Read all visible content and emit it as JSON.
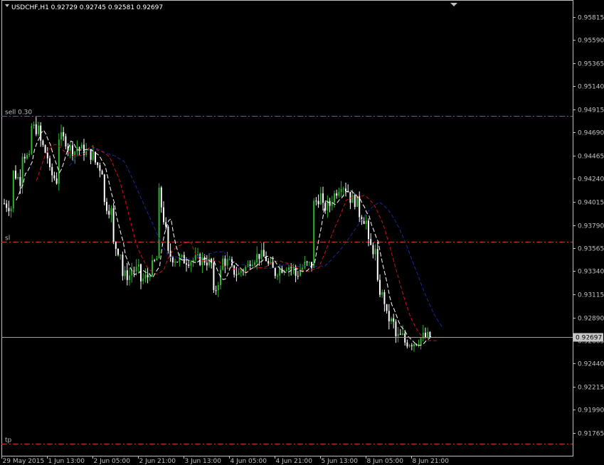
{
  "chart_data": {
    "type": "candlestick",
    "title": "USDCHF,H1 0.92729 0.92745 0.92581 0.92697",
    "symbol": "USDCHF",
    "timeframe": "H1",
    "ohlc_header": {
      "open": "0.92729",
      "high": "0.92745",
      "low": "0.92581",
      "close": "0.92697"
    },
    "current_price": 0.92697,
    "current_price_label": "0.92697",
    "ylim": [
      0.9155,
      0.9598
    ],
    "y_ticks": [
      0.95815,
      0.9559,
      0.95365,
      0.9514,
      0.94915,
      0.9469,
      0.94465,
      0.9424,
      0.94015,
      0.9379,
      0.93565,
      0.9334,
      0.93115,
      0.9289,
      0.92665,
      0.9244,
      0.92215,
      0.9199,
      0.91765
    ],
    "y_tick_labels": [
      "0.95815",
      "0.95590",
      "0.95365",
      "0.95140",
      "0.94915",
      "0.94690",
      "0.94465",
      "0.94240",
      "0.94015",
      "0.93790",
      "0.93565",
      "0.93340",
      "0.93115",
      "0.92890",
      "0.92665",
      "0.92440",
      "0.92215",
      "0.91990",
      "0.91765"
    ],
    "x_tick_labels": [
      "29 May 2015",
      "1 Jun 13:00",
      "2 Jun 05:00",
      "2 Jun 21:00",
      "3 Jun 13:00",
      "4 Jun 05:00",
      "4 Jun 21:00",
      "5 Jun 13:00",
      "8 Jun 05:00",
      "8 Jun 21:00"
    ],
    "levels": [
      {
        "name": "sell 0.30",
        "price": 0.9485,
        "color": "#2e8b2e"
      },
      {
        "name": "sl",
        "price": 0.9363,
        "color": "#c0392b"
      },
      {
        "name": "tp",
        "price": 0.9166,
        "color": "#c0392b"
      }
    ],
    "colors": {
      "bull": "#2bb52b",
      "bear": "#ffffff",
      "ma_fast": "#ffffff",
      "ma_mid": "#d01010",
      "ma_slow": "#1a2a9a",
      "grid": "#3a3a3a",
      "axis": "#c0c0c0"
    },
    "price_path": [
      [
        0.94,
        0.9395
      ],
      [
        0.943,
        0.942
      ],
      [
        0.945,
        0.944
      ],
      [
        0.9475,
        0.947
      ],
      [
        0.946,
        0.944
      ],
      [
        0.943,
        0.942
      ],
      [
        0.9465,
        0.946
      ],
      [
        0.9455,
        0.945
      ],
      [
        0.9455,
        0.945
      ],
      [
        0.945,
        0.9445
      ],
      [
        0.944,
        0.943
      ],
      [
        0.94,
        0.939
      ],
      [
        0.936,
        0.935
      ],
      [
        0.933,
        0.933
      ],
      [
        0.9335,
        0.9335
      ],
      [
        0.9325,
        0.933
      ],
      [
        0.9335,
        0.935
      ],
      [
        0.941,
        0.936
      ],
      [
        0.935,
        0.9345
      ],
      [
        0.9345,
        0.9345
      ],
      [
        0.9345,
        0.9345
      ],
      [
        0.9345,
        0.9345
      ],
      [
        0.9345,
        0.934
      ],
      [
        0.931,
        0.934
      ],
      [
        0.9345,
        0.934
      ],
      [
        0.9335,
        0.933
      ],
      [
        0.9335,
        0.934
      ],
      [
        0.9345,
        0.935
      ],
      [
        0.935,
        0.9345
      ],
      [
        0.934,
        0.933
      ],
      [
        0.9335,
        0.934
      ],
      [
        0.934,
        0.9335
      ],
      [
        0.933,
        0.934
      ],
      [
        0.934,
        0.934
      ],
      [
        0.94,
        0.941
      ],
      [
        0.9395,
        0.94
      ],
      [
        0.9405,
        0.942
      ],
      [
        0.942,
        0.941
      ],
      [
        0.9405,
        0.94
      ],
      [
        0.939,
        0.938
      ],
      [
        0.936,
        0.935
      ],
      [
        0.932,
        0.93
      ],
      [
        0.929,
        0.928
      ],
      [
        0.927,
        0.927
      ],
      [
        0.9265,
        0.9265
      ],
      [
        0.9265,
        0.927
      ],
      [
        0.927,
        0.927
      ]
    ],
    "ma_period_values": {
      "fast": 5,
      "mid": 12,
      "slow": 24
    }
  }
}
